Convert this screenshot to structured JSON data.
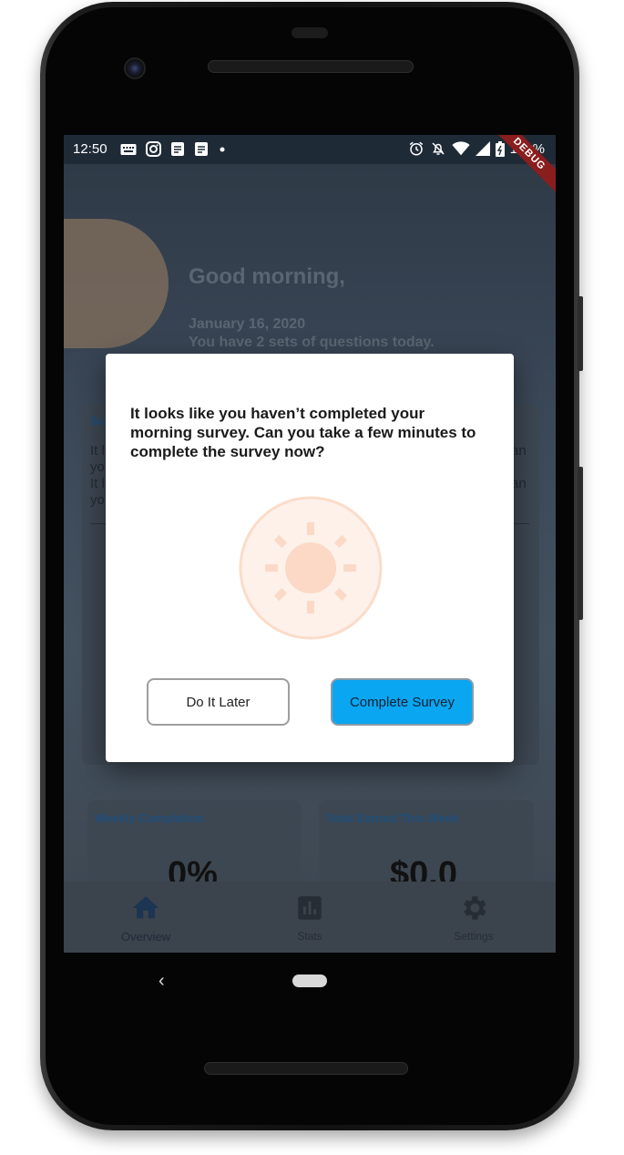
{
  "status_bar": {
    "time": "12:50",
    "battery": "100%",
    "debug_label": "DEBUG"
  },
  "home": {
    "greeting": "Good morning,",
    "date": "January 16, 2020",
    "questions_today": "You have 2 sets of questions today.",
    "card_header": "Su",
    "card_lines": [
      "It l",
      "yo",
      "It l",
      "yo"
    ],
    "card_lines_right": [
      "an",
      "an"
    ],
    "weekly_completion_title": "Weekly Completion",
    "weekly_completion_value": "0%",
    "total_earned_title": "Total Earned This Week",
    "total_earned_value": "$0.0"
  },
  "dialog": {
    "message": "It looks like you haven’t completed your morning survey. Can you take a few minutes to complete the survey now?",
    "later_label": "Do It Later",
    "complete_label": "Complete Survey"
  },
  "bottom_nav": {
    "items": [
      {
        "label": "Overview",
        "icon": "home-icon"
      },
      {
        "label": "Stats",
        "icon": "stats-icon"
      },
      {
        "label": "Settings",
        "icon": "settings-icon"
      }
    ]
  },
  "colors": {
    "accent": "#0aa6f1",
    "sun_light": "#fbe8dd",
    "sun_core": "#fbd9c6"
  }
}
